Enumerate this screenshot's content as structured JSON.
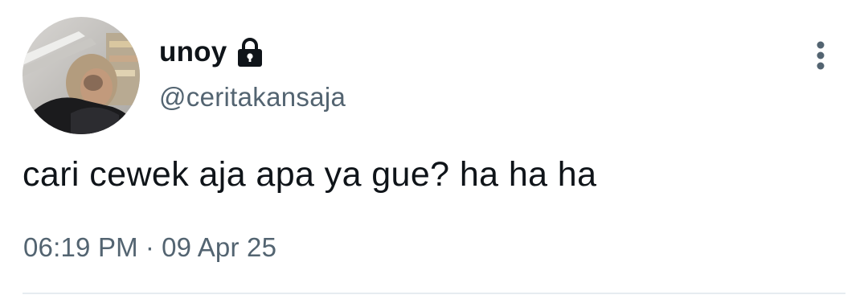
{
  "tweet": {
    "display_name": "unoy",
    "handle": "@ceritakansaja",
    "text": "cari cewek aja apa ya gue? ha ha ha",
    "time": "06:19 PM",
    "separator": "·",
    "date": "09 Apr 25",
    "icons": {
      "lock": "lock-icon",
      "more": "more-vertical-icon",
      "avatar": "profile-photo"
    }
  },
  "colors": {
    "text_primary": "#0f1419",
    "text_secondary": "#536471",
    "divider": "#e6ecf0"
  }
}
